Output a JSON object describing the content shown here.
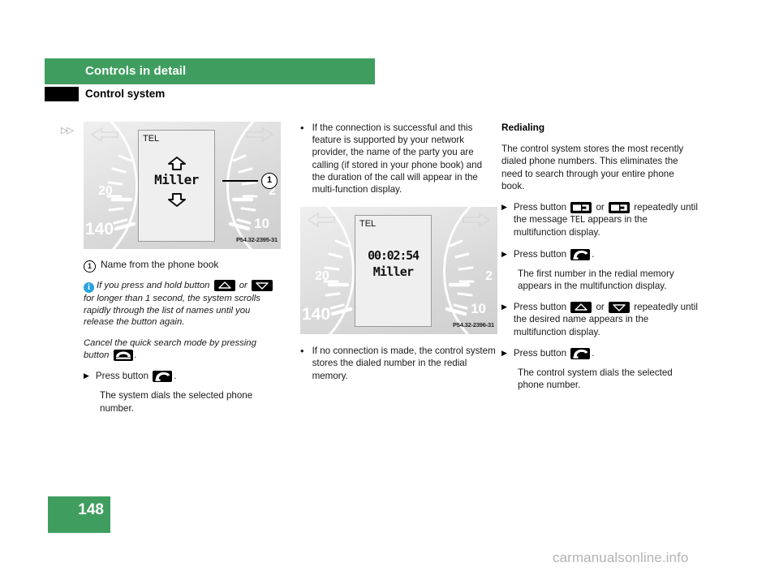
{
  "header": {
    "chapter": "Controls in detail",
    "section": "Control system",
    "band_color": "#3f9e5f"
  },
  "footer": {
    "page_number": "148",
    "watermark": "carmanualsonline.info"
  },
  "figures": {
    "fig1": {
      "code": "P54.32-2395-31",
      "lcd_label": "TEL",
      "lcd_name": "Miller",
      "gauge_left_small": "20",
      "gauge_left_big": "140",
      "gauge_right_small": "2",
      "gauge_right_big": "10",
      "callout_number": "1"
    },
    "fig2": {
      "code": "P54.32-2396-31",
      "lcd_label": "TEL",
      "lcd_time": "00:02:54",
      "lcd_name": "Miller",
      "gauge_left_small": "20",
      "gauge_left_big": "140",
      "gauge_right_small": "2",
      "gauge_right_big": "10"
    }
  },
  "column1": {
    "legend_number": "1",
    "legend_text": "Name from the phone book",
    "note_part1": "If you press and hold button",
    "note_or": "or",
    "note_part2": "for longer than 1 second, the system scrolls rapidly through the list of names until you release the button again.",
    "cancel_part1": "Cancel the quick search mode by pressing button",
    "cancel_part2": ".",
    "step_press_label": "Press button",
    "step_press_end": ".",
    "step_result": "The system dials the selected phone number."
  },
  "column2": {
    "bullet1": "If the connection is successful and this feature is supported by your network provider, the name of the party you are calling (if stored in your phone book) and the duration of the call will appear in the multi-function display.",
    "bullet2": "If no connection is made, the control system stores the dialed number in the redial memory."
  },
  "column3": {
    "heading": "Redialing",
    "intro": "The control system stores the most recently dialed phone numbers. This eliminates the need to search through your entire phone book.",
    "step1_label": "Press button",
    "step1_or": "or",
    "step1_tail_a": "repeatedly until the message",
    "step1_code": "TEL",
    "step1_tail_b": "appears in the multifunction display.",
    "step2_label": "Press button",
    "step2_end": ".",
    "step2_result": "The first number in the redial memory appears in the multifunction display.",
    "step3_label": "Press button",
    "step3_or": "or",
    "step3_tail": "repeatedly until the desired name appears in the multifunction display.",
    "step4_label": "Press button",
    "step4_end": ".",
    "step4_result": "The control system dials the selected phone number."
  }
}
